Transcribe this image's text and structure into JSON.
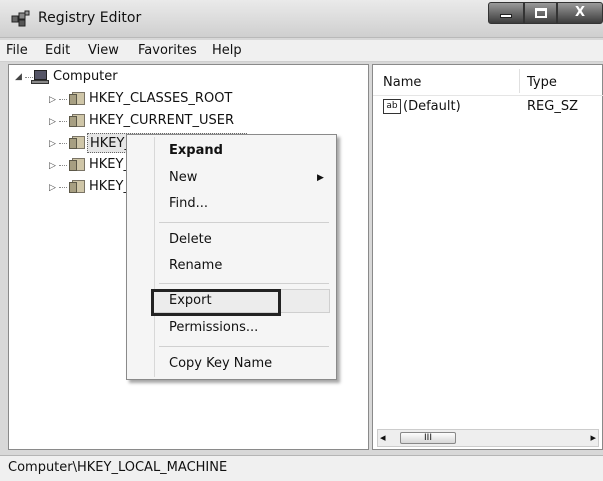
{
  "window": {
    "title": "Registry Editor",
    "app_icon": "registry-editor-icon"
  },
  "caption_buttons": {
    "minimize": "minimize-icon",
    "maximize": "maximize-icon",
    "close": "X"
  },
  "menu": [
    "File",
    "Edit",
    "View",
    "Favorites",
    "Help"
  ],
  "tree": {
    "root": "Computer",
    "items": [
      "HKEY_CLASSES_ROOT",
      "HKEY_CURRENT_USER",
      "HKEY_",
      "HKEY_",
      "HKEY_"
    ]
  },
  "values_pane": {
    "columns": [
      "Name",
      "Type"
    ],
    "rows": [
      {
        "icon": "ab",
        "name": "(Default)",
        "type": "REG_SZ"
      }
    ],
    "scroll_thumb": "III"
  },
  "context_menu": {
    "items": [
      "Expand",
      "New",
      "Find...",
      "Delete",
      "Rename",
      "Export",
      "Permissions...",
      "Copy Key Name"
    ],
    "highlighted": "Export"
  },
  "status_bar": {
    "path": "Computer\\HKEY_LOCAL_MACHINE"
  }
}
